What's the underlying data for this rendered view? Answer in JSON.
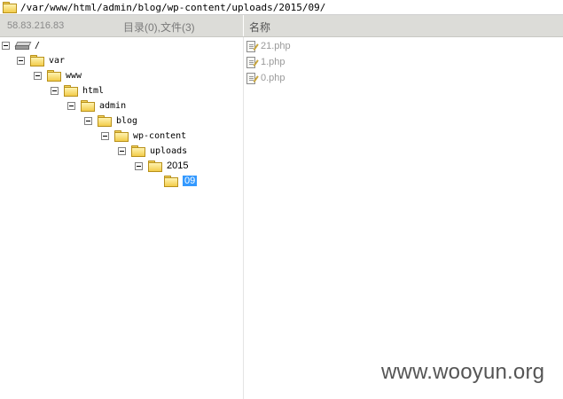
{
  "path_bar": {
    "path": "/var/www/html/admin/blog/wp-content/uploads/2015/09/"
  },
  "header": {
    "host": "58.83.216.83",
    "summary": "目录(0),文件(3)",
    "column_name": "名称"
  },
  "tree": {
    "root": "/",
    "var": "var",
    "www": "www",
    "html": "html",
    "admin": "admin",
    "blog": "blog",
    "wp_content": "wp-content",
    "uploads": "uploads",
    "y2015": "2015",
    "m09": "09"
  },
  "files": [
    "21.php",
    "1.php",
    "0.php"
  ],
  "watermark": "www.wooyun.org",
  "colors": {
    "selection": "#3399ff",
    "header_bg": "#dcdcd8",
    "folder_fill": "#f2cc4a"
  },
  "icons": {
    "folder": "folder-icon",
    "drive": "drive-icon",
    "file": "php-file-icon",
    "expander": "collapse-box-icon"
  }
}
